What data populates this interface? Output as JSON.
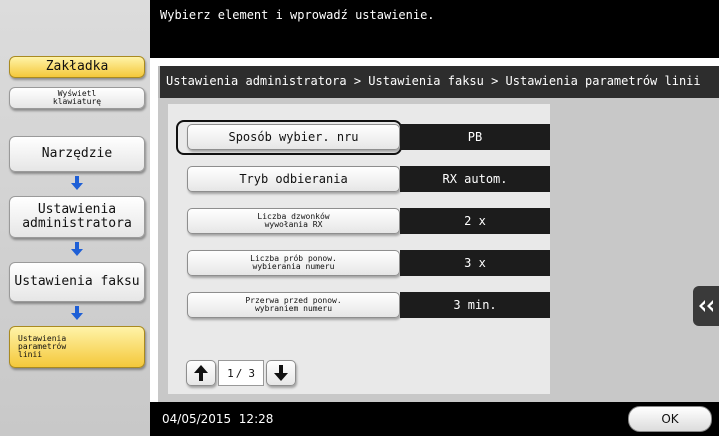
{
  "message": "Wybierz element i wprowadź ustawienie.",
  "sidebar": {
    "tab_label": "Zakładka",
    "keyboard_label": "Wyświetl klawiaturę",
    "steps": [
      "Narzędzie",
      "Ustawienia administratora",
      "Ustawienia faksu",
      "Ustawienia parametrów linii"
    ]
  },
  "breadcrumb": "Ustawienia administratora > Ustawienia faksu > Ustawienia parametrów linii",
  "settings": [
    {
      "label": "Sposób wybier. nru",
      "value": "PB"
    },
    {
      "label": "Tryb odbierania",
      "value": "RX autom."
    },
    {
      "label": "Liczba dzwonków wywołania RX",
      "value": "2 x"
    },
    {
      "label": "Liczba prób ponow. wybierania numeru",
      "value": "3 x"
    },
    {
      "label": "Przerwa przed ponow. wybraniem numeru",
      "value": "3 min."
    }
  ],
  "pager": {
    "current": "1",
    "separator": "/",
    "total": "3"
  },
  "footer": {
    "datetime": "04/05/2015  12:28",
    "ok_label": "OK"
  },
  "icons": {
    "arrow_down": "arrow-down-icon",
    "arrow_up": "arrow-up-icon",
    "collapse": "double-chevron-left-icon"
  },
  "colors": {
    "highlight_yellow": "#f4c83a",
    "value_bg": "#1c1c1c",
    "step_arrow": "#1e5fd6"
  }
}
